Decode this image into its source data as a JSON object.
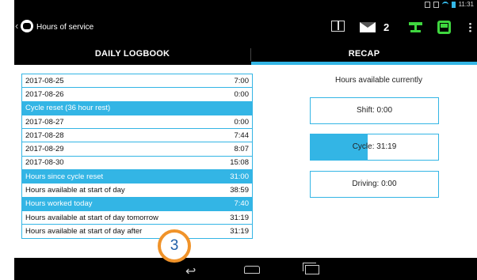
{
  "status_bar": {
    "time": "11:31"
  },
  "action_bar": {
    "title": "Hours of service",
    "message_count": "2"
  },
  "tabs": [
    {
      "label": "DAILY LOGBOOK",
      "active": false
    },
    {
      "label": "RECAP",
      "active": true
    }
  ],
  "log_rows": [
    {
      "label": "2017-08-25",
      "value": "7:00",
      "highlight": false
    },
    {
      "label": "2017-08-26",
      "value": "0:00",
      "highlight": false
    },
    {
      "label": "Cycle reset (36 hour rest)",
      "value": "",
      "highlight": true
    },
    {
      "label": "2017-08-27",
      "value": "0:00",
      "highlight": false
    },
    {
      "label": "2017-08-28",
      "value": "7:44",
      "highlight": false
    },
    {
      "label": "2017-08-29",
      "value": "8:07",
      "highlight": false
    },
    {
      "label": "2017-08-30",
      "value": "15:08",
      "highlight": false
    },
    {
      "label": "Hours since cycle reset",
      "value": "31:00",
      "highlight": true
    },
    {
      "label": "Hours available at start of day",
      "value": "38:59",
      "highlight": false
    },
    {
      "label": "Hours worked today",
      "value": "7:40",
      "highlight": true
    },
    {
      "label": "Hours available at start of day tomorrow",
      "value": "31:19",
      "highlight": false
    },
    {
      "label": "Hours available at start of day after",
      "value": "31:19",
      "highlight": false
    }
  ],
  "recap": {
    "title": "Hours available currently",
    "shift": {
      "label": "Shift: 0:00",
      "fill_fraction": 0
    },
    "cycle": {
      "label": "Cycle: 31:19",
      "fill_fraction": 0.45
    },
    "driving": {
      "label": "Driving: 0:00",
      "fill_fraction": 0
    }
  },
  "badge": {
    "number": "3",
    "border_color": "#f0932a",
    "text_color": "#1e5fa8"
  },
  "colors": {
    "accent": "#33b5e5",
    "status_green": "#3fd63f"
  }
}
